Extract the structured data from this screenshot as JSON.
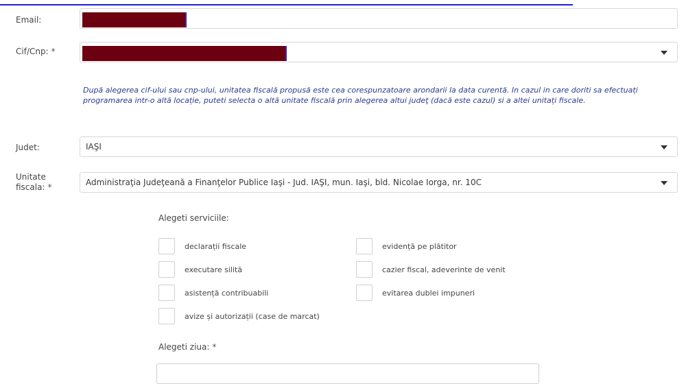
{
  "form": {
    "email_label": "Email:",
    "cif_label": "Cif/Cnp:",
    "required_mark": "*",
    "note": "După alegerea cif-ului sau cnp-ului, unitatea fiscală propusă este cea corespunzatoare arondarii la data curentă. In cazul in care doriti sa efectuați programarea intr-o altă locație, puteti selecta o altă unitate fiscală prin alegerea altui judeţ (dacă este cazul) si a altei unitați fiscale.",
    "judet_label": "Judet:",
    "judet_value": "IAŞI",
    "unitate_label_line1": "Unitate",
    "unitate_label_line2": "fiscala:",
    "unitate_value": "Administraţia Judeţeană a Finanţelor Publice Iaşi - Jud. IAŞI, mun. Iaşi, bld. Nicolae Iorga, nr. 10C",
    "services_title": "Alegeti serviciile:",
    "services_left": [
      "declarații fiscale",
      "executare silită",
      "asistență contribuabili",
      "avize și autorizații (case de marcat)"
    ],
    "services_right": [
      "evidență pe plătitor",
      "cazier fiscal, adeverinte de venit",
      "evitarea dublei impuneri"
    ],
    "day_label": "Alegeti ziua:"
  },
  "colors": {
    "redaction": "#6d0010",
    "note_text": "#2b3a8c",
    "link": "#1f1fd6"
  }
}
